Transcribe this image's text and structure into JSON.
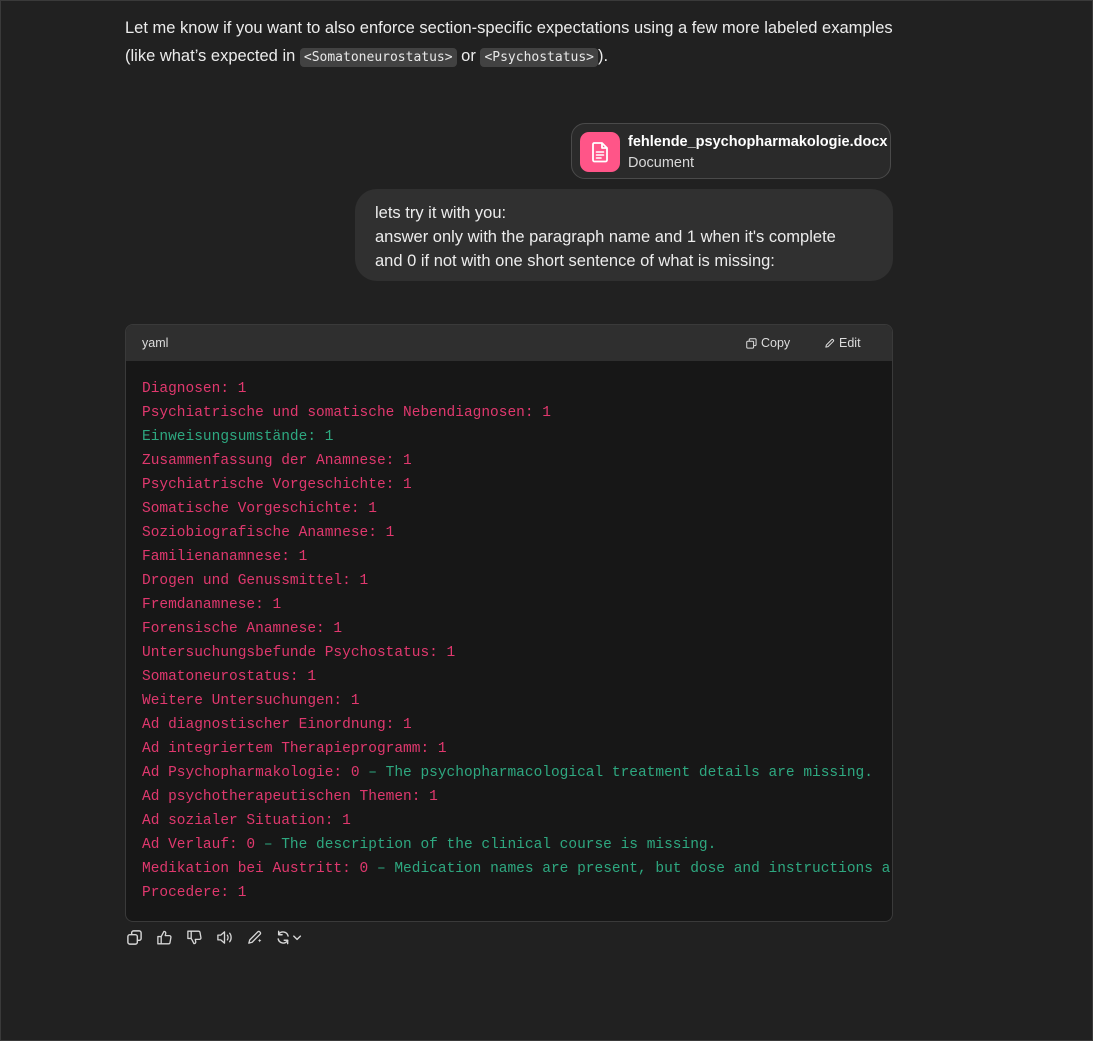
{
  "intro": {
    "text_before": "Let me know if you want to also enforce section-specific expectations using a few more labeled examples (like what’s expected in ",
    "code1": "<Somatoneurostatus>",
    "text_mid": " or ",
    "code2": "<Psychostatus>",
    "text_after": ")."
  },
  "attachment": {
    "file_name": "fehlende_psychopharmakologie.docx",
    "file_type": "Document",
    "icon": "document-icon",
    "icon_color": "#ff5588"
  },
  "user_message": {
    "lines": [
      "lets try it with you:",
      "answer only with the paragraph name and 1 when it's complete",
      "and 0 if not with one short sentence of what is missing:"
    ]
  },
  "code_block": {
    "language": "yaml",
    "copy_label": "Copy",
    "edit_label": "Edit",
    "lines": [
      {
        "key": "Diagnosen:",
        "value": " 1",
        "style": "k"
      },
      {
        "key": "Psychiatrische und somatische Nebendiagnosen:",
        "value": " 1",
        "style": "k"
      },
      {
        "key": "Einweisungsumstände:",
        "value": " 1",
        "style": "s"
      },
      {
        "key": "Zusammenfassung der Anamnese:",
        "value": " 1",
        "style": "k"
      },
      {
        "key": "Psychiatrische Vorgeschichte:",
        "value": " 1",
        "style": "k"
      },
      {
        "key": "Somatische Vorgeschichte:",
        "value": " 1",
        "style": "k"
      },
      {
        "key": "Soziobiografische Anamnese:",
        "value": " 1",
        "style": "k"
      },
      {
        "key": "Familienanamnese:",
        "value": " 1",
        "style": "k"
      },
      {
        "key": "Drogen und Genussmittel:",
        "value": " 1",
        "style": "k"
      },
      {
        "key": "Fremdanamnese:",
        "value": " 1",
        "style": "k"
      },
      {
        "key": "Forensische Anamnese:",
        "value": " 1",
        "style": "k"
      },
      {
        "key": "Untersuchungsbefunde Psychostatus:",
        "value": " 1",
        "style": "k"
      },
      {
        "key": "Somatoneurostatus:",
        "value": " 1",
        "style": "k"
      },
      {
        "key": "Weitere Untersuchungen:",
        "value": " 1",
        "style": "k"
      },
      {
        "key": "Ad diagnostischer Einordnung:",
        "value": " 1",
        "style": "k"
      },
      {
        "key": "Ad integriertem Therapieprogramm:",
        "value": " 1",
        "style": "k"
      },
      {
        "key": "Ad Psychopharmakologie: 0",
        "value": " – The psychopharmacological treatment details are missing.",
        "style": "k"
      },
      {
        "key": "Ad psychotherapeutischen Themen:",
        "value": " 1",
        "style": "k"
      },
      {
        "key": "Ad sozialer Situation:",
        "value": " 1",
        "style": "k"
      },
      {
        "key": "Ad Verlauf: 0",
        "value": " – The description of the clinical course is missing.",
        "style": "k"
      },
      {
        "key": "Medikation bei Austritt: 0",
        "value": " – Medication names are present, but dose and instructions are i",
        "style": "k"
      },
      {
        "key": "Procedere:",
        "value": " 1",
        "style": "k"
      }
    ]
  },
  "actions": [
    {
      "name": "copy-icon"
    },
    {
      "name": "thumbs-up-icon"
    },
    {
      "name": "thumbs-down-icon"
    },
    {
      "name": "read-aloud-icon"
    },
    {
      "name": "edit-pen-icon"
    },
    {
      "name": "regenerate-icon"
    }
  ],
  "colors": {
    "key_color": "#e0386e",
    "string_color": "#2ea880",
    "background": "#212121"
  }
}
